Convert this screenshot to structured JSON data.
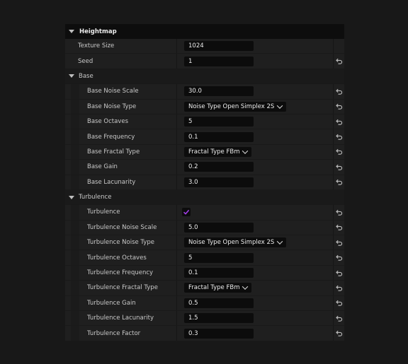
{
  "heightmap": {
    "title": "Heightmap",
    "top_props": [
      {
        "name": "texture-size",
        "label": "Texture Size",
        "value": "1024",
        "kind": "number",
        "reset": false
      },
      {
        "name": "seed",
        "label": "Seed",
        "value": "1",
        "kind": "number",
        "reset": true
      }
    ]
  },
  "base": {
    "title": "Base",
    "props": [
      {
        "name": "base-noise-scale",
        "label": "Base Noise Scale",
        "value": "30.0",
        "kind": "number"
      },
      {
        "name": "base-noise-type",
        "label": "Base Noise Type",
        "value": "Noise Type Open Simplex 2S",
        "kind": "combo"
      },
      {
        "name": "base-octaves",
        "label": "Base Octaves",
        "value": "5",
        "kind": "number"
      },
      {
        "name": "base-frequency",
        "label": "Base Frequency",
        "value": "0.1",
        "kind": "number"
      },
      {
        "name": "base-fractal-type",
        "label": "Base Fractal Type",
        "value": "Fractal Type FBm",
        "kind": "combo"
      },
      {
        "name": "base-gain",
        "label": "Base Gain",
        "value": "0.2",
        "kind": "number"
      },
      {
        "name": "base-lacunarity",
        "label": "Base Lacunarity",
        "value": "3.0",
        "kind": "number"
      }
    ]
  },
  "turbulence": {
    "title": "Turbulence",
    "props": [
      {
        "name": "turbulence-enabled",
        "label": "Turbulence",
        "value": true,
        "kind": "check"
      },
      {
        "name": "turbulence-noise-scale",
        "label": "Turbulence Noise Scale",
        "value": "5.0",
        "kind": "number"
      },
      {
        "name": "turbulence-noise-type",
        "label": "Turbulence Noise Type",
        "value": "Noise Type Open Simplex 2S",
        "kind": "combo"
      },
      {
        "name": "turbulence-octaves",
        "label": "Turbulence Octaves",
        "value": "5",
        "kind": "number"
      },
      {
        "name": "turbulence-frequency",
        "label": "Turbulence Frequency",
        "value": "0.1",
        "kind": "number"
      },
      {
        "name": "turbulence-fractal-type",
        "label": "Turbulence Fractal Type",
        "value": "Fractal Type FBm",
        "kind": "combo"
      },
      {
        "name": "turbulence-gain",
        "label": "Turbulence Gain",
        "value": "0.5",
        "kind": "number"
      },
      {
        "name": "turbulence-lacunarity",
        "label": "Turbulence Lacunarity",
        "value": "1.5",
        "kind": "number"
      },
      {
        "name": "turbulence-factor",
        "label": "Turbulence Factor",
        "value": "0.3",
        "kind": "number"
      }
    ]
  },
  "colors": {
    "checkbox_accent": "#a23ee6",
    "background": "#181818"
  },
  "icons": {
    "collapse": "caret-down-icon",
    "reset": "reset-arrow-icon",
    "dropdown": "chevron-down-icon",
    "check": "checkmark-icon"
  }
}
